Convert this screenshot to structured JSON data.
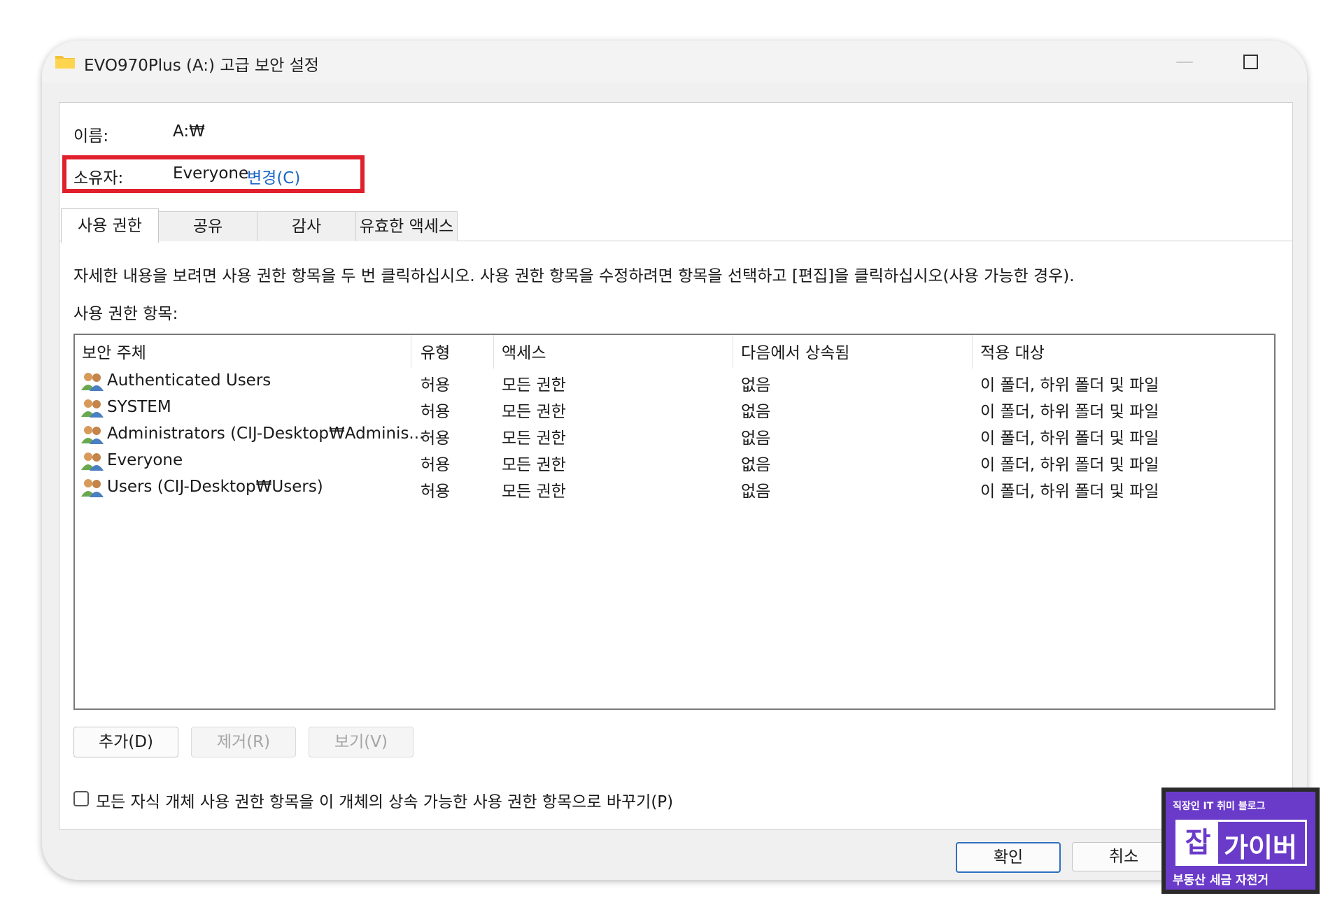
{
  "window": {
    "title": "EVO970Plus (A:) 고급 보안 설정",
    "minimize_glyph": "—",
    "close_glyph": "✕"
  },
  "info": {
    "name_label": "이름:",
    "name_value": "A:₩",
    "owner_label": "소유자:",
    "owner_value": "Everyone",
    "change_link": "변경(C)"
  },
  "tabs": [
    {
      "label": "사용 권한"
    },
    {
      "label": "공유"
    },
    {
      "label": "감사"
    },
    {
      "label": "유효한 액세스"
    }
  ],
  "instructions": "자세한 내용을 보려면 사용 권한 항목을 두 번 클릭하십시오. 사용 권한 항목을 수정하려면 항목을 선택하고 [편집]을 클릭하십시오(사용 가능한 경우).",
  "entries_label": "사용 권한 항목:",
  "columns": [
    "보안 주체",
    "유형",
    "액세스",
    "다음에서 상속됨",
    "적용 대상"
  ],
  "rows": [
    {
      "principal": "Authenticated Users",
      "type": "허용",
      "access": "모든 권한",
      "inherited": "없음",
      "applies": "이 폴더, 하위 폴더 및 파일"
    },
    {
      "principal": "SYSTEM",
      "type": "허용",
      "access": "모든 권한",
      "inherited": "없음",
      "applies": "이 폴더, 하위 폴더 및 파일"
    },
    {
      "principal": "Administrators (CIJ-Desktop₩Adminis...",
      "type": "허용",
      "access": "모든 권한",
      "inherited": "없음",
      "applies": "이 폴더, 하위 폴더 및 파일"
    },
    {
      "principal": "Everyone",
      "type": "허용",
      "access": "모든 권한",
      "inherited": "없음",
      "applies": "이 폴더, 하위 폴더 및 파일"
    },
    {
      "principal": "Users (CIJ-Desktop₩Users)",
      "type": "허용",
      "access": "모든 권한",
      "inherited": "없음",
      "applies": "이 폴더, 하위 폴더 및 파일"
    }
  ],
  "buttons": {
    "add": "추가(D)",
    "remove": "제거(R)",
    "view": "보기(V)"
  },
  "checkbox_label": "모든 자식 개체 사용 권한 항목을 이 개체의 상속 가능한 사용 권한 항목으로 바꾸기(P)",
  "footer": {
    "ok": "확인",
    "cancel": "취소"
  },
  "badge": {
    "top": "직장인 IT 취미 블로그",
    "jab": "잡",
    "name": "가이버",
    "bottom": "부동산 세금 자전거"
  },
  "colors": {
    "highlight_border": "#e0202d",
    "link": "#1a66c6",
    "badge_purple": "#6a3bc9"
  }
}
